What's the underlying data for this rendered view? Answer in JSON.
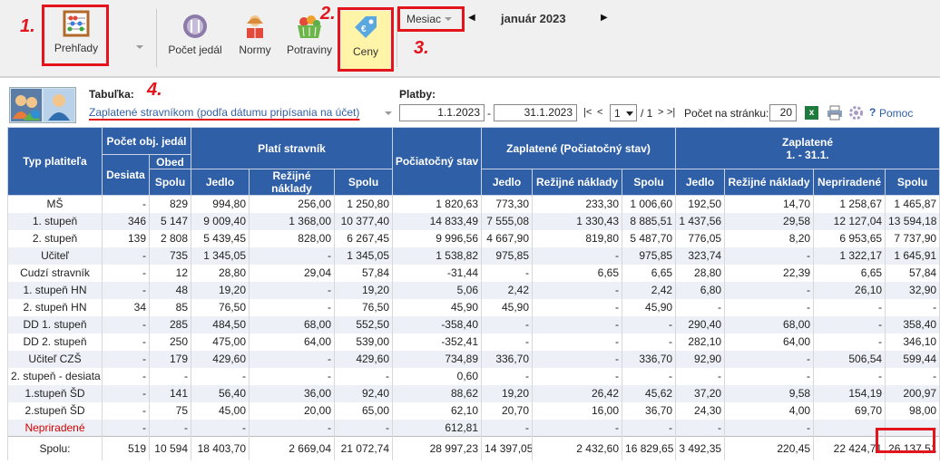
{
  "toolbar": {
    "prehlady": "Prehľady",
    "pocet_jedal": "Počet jedál",
    "normy": "Normy",
    "potraviny": "Potraviny",
    "ceny": "Ceny",
    "month_mode": "Mesiac",
    "period": "január 2023",
    "prev_glyph": "◀",
    "next_glyph": "▶"
  },
  "annotations": {
    "n1": "1.",
    "n2": "2.",
    "n3": "3.",
    "n4": "4."
  },
  "filter": {
    "tabulka_label": "Tabuľka:",
    "tabulka_value": "Zaplatené stravníkom (podľa dátumu pripísania na účet)",
    "platby_label": "Platby:",
    "date_from": "1.1.2023",
    "date_sep": "-",
    "date_to": "31.1.2023",
    "pager_first": "|<",
    "pager_prev": "<",
    "page": "1",
    "page_total": "/ 1",
    "pager_next": ">",
    "pager_last": ">|",
    "per_page_label": "Počet na stránku:",
    "per_page": "20",
    "help": "Pomoc"
  },
  "table": {
    "h_typ": "Typ platiteľa",
    "h_pocet": "Počet obj. jedál",
    "h_plati": "Platí stravník",
    "h_poc_stav": "Počiatočný stav",
    "h_zapl_poc": "Zaplatené (Počiatočný stav)",
    "h_zapl": "Zaplatené",
    "h_zapl_range": "1. - 31.1.",
    "h_desiata": "Desiata",
    "h_obed": "Obed",
    "h_spolu": "Spolu",
    "h_jedlo": "Jedlo",
    "h_rezia": "Režijné náklady",
    "h_nepri": "Nepriradené",
    "rows": [
      [
        "MŠ",
        "-",
        "829",
        "994,80",
        "256,00",
        "1 250,80",
        "1 820,63",
        "773,30",
        "233,30",
        "1 006,60",
        "192,50",
        "14,70",
        "1 258,67",
        "1 465,87"
      ],
      [
        "1. stupeň",
        "346",
        "5 147",
        "9 009,40",
        "1 368,00",
        "10 377,40",
        "14 833,49",
        "7 555,08",
        "1 330,43",
        "8 885,51",
        "1 437,56",
        "29,58",
        "12 127,04",
        "13 594,18"
      ],
      [
        "2. stupeň",
        "139",
        "2 808",
        "5 439,45",
        "828,00",
        "6 267,45",
        "9 996,56",
        "4 667,90",
        "819,80",
        "5 487,70",
        "776,05",
        "8,20",
        "6 953,65",
        "7 737,90"
      ],
      [
        "Učiteľ",
        "-",
        "735",
        "1 345,05",
        "-",
        "1 345,05",
        "1 538,82",
        "975,85",
        "-",
        "975,85",
        "323,74",
        "-",
        "1 322,17",
        "1 645,91"
      ],
      [
        "Cudzí stravník",
        "-",
        "12",
        "28,80",
        "29,04",
        "57,84",
        "-31,44",
        "-",
        "6,65",
        "6,65",
        "28,80",
        "22,39",
        "6,65",
        "57,84"
      ],
      [
        "1. stupeň HN",
        "-",
        "48",
        "19,20",
        "-",
        "19,20",
        "5,06",
        "2,42",
        "-",
        "2,42",
        "6,80",
        "-",
        "26,10",
        "32,90"
      ],
      [
        "2. stupeň HN",
        "34",
        "85",
        "76,50",
        "-",
        "76,50",
        "45,90",
        "45,90",
        "-",
        "45,90",
        "-",
        "-",
        "-",
        "-"
      ],
      [
        "DD 1. stupeň",
        "-",
        "285",
        "484,50",
        "68,00",
        "552,50",
        "-358,40",
        "-",
        "-",
        "-",
        "290,40",
        "68,00",
        "-",
        "358,40"
      ],
      [
        "DD 2. stupeň",
        "-",
        "250",
        "475,00",
        "64,00",
        "539,00",
        "-352,41",
        "-",
        "-",
        "-",
        "282,10",
        "64,00",
        "-",
        "346,10"
      ],
      [
        "Učiteľ CZŠ",
        "-",
        "179",
        "429,60",
        "-",
        "429,60",
        "734,89",
        "336,70",
        "-",
        "336,70",
        "92,90",
        "-",
        "506,54",
        "599,44"
      ],
      [
        "2. stupeň - desiata",
        "-",
        "-",
        "-",
        "-",
        "-",
        "0,60",
        "-",
        "-",
        "-",
        "-",
        "-",
        "-",
        "-"
      ],
      [
        "1.stupeň ŠD",
        "-",
        "141",
        "56,40",
        "36,00",
        "92,40",
        "88,62",
        "19,20",
        "26,42",
        "45,62",
        "37,20",
        "9,58",
        "154,19",
        "200,97"
      ],
      [
        "2.stupeň ŠD",
        "-",
        "75",
        "45,00",
        "20,00",
        "65,00",
        "62,10",
        "20,70",
        "16,00",
        "36,70",
        "24,30",
        "4,00",
        "69,70",
        "98,00"
      ],
      [
        "Nepriradené",
        "-",
        "-",
        "-",
        "-",
        "-",
        "612,81",
        "-",
        "-",
        "-",
        "-",
        "-",
        "-",
        "-"
      ]
    ],
    "total": [
      "Spolu:",
      "519",
      "10 594",
      "18 403,70",
      "2 669,04",
      "21 072,74",
      "28 997,23",
      "14 397,05",
      "2 432,60",
      "16 829,65",
      "3 492,35",
      "220,45",
      "22 424,71",
      "26 137,51"
    ]
  }
}
